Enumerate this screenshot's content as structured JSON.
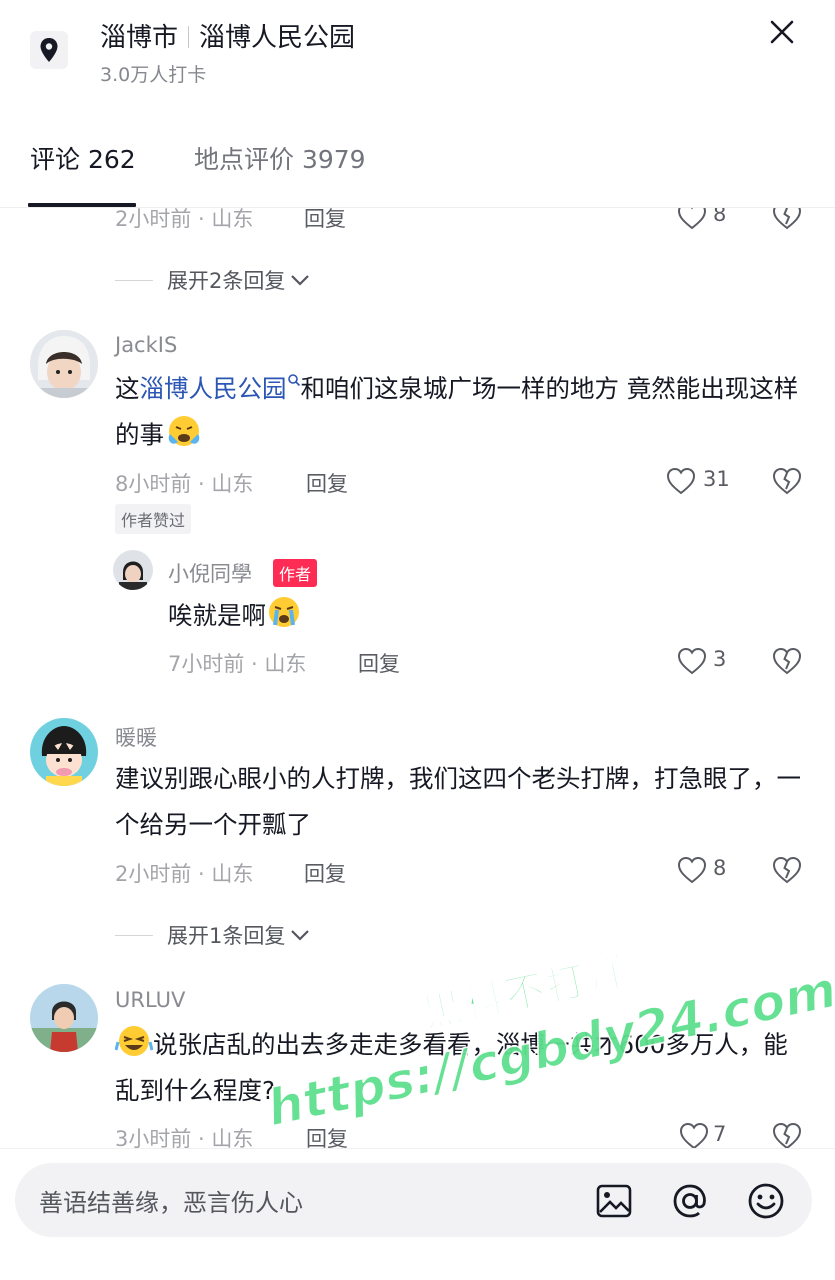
{
  "header": {
    "city": "淄博市",
    "place": "淄博人民公园",
    "checkins": "3.0万人打卡"
  },
  "tabs": [
    {
      "label": "评论 262",
      "active": true
    },
    {
      "label": "地点评价 3979",
      "active": false
    }
  ],
  "comments": [
    {
      "meta": "2小时前 · 山东",
      "reply_label": "回复",
      "likes": "8",
      "expand": "展开2条回复"
    },
    {
      "username": "JackIS",
      "text_pre": "这",
      "text_link": "淄博人民公园",
      "text_post": "和咱们这泉城广场一样的地方 竟然能出现这样的事",
      "meta": "8小时前 · 山东",
      "reply_label": "回复",
      "likes": "31",
      "badge": "作者赞过",
      "reply": {
        "username": "小倪同學",
        "author_badge": "作者",
        "text": "唉就是啊",
        "meta": "7小时前 · 山东",
        "reply_label": "回复",
        "likes": "3"
      }
    },
    {
      "username": "暖暖",
      "text": "建议别跟心眼小的人打牌，我们这四个老头打牌，打急眼了，一个给另一个开瓢了",
      "meta": "2小时前 · 山东",
      "reply_label": "回复",
      "likes": "8",
      "expand": "展开1条回复"
    },
    {
      "username": "URLUV",
      "text": "说张店乱的出去多走走多看看，淄博一共才600多万人，能乱到什么程度?",
      "meta": "3小时前 · 山东",
      "reply_label": "回复",
      "likes": "7"
    }
  ],
  "watermark": {
    "line1": "黑料不打烊",
    "line2": "https://cgbdy24.com"
  },
  "input": {
    "placeholder": "善语结善缘，恶言伤人心"
  },
  "colors": {
    "link": "#2b56b4",
    "author_badge": "#fe2c55",
    "watermark": "#5ee08e"
  },
  "icons": [
    "location-pin-icon",
    "close-icon",
    "heart-icon",
    "dislike-heart-icon",
    "chevron-down-icon",
    "image-icon",
    "at-icon",
    "emoji-icon"
  ]
}
